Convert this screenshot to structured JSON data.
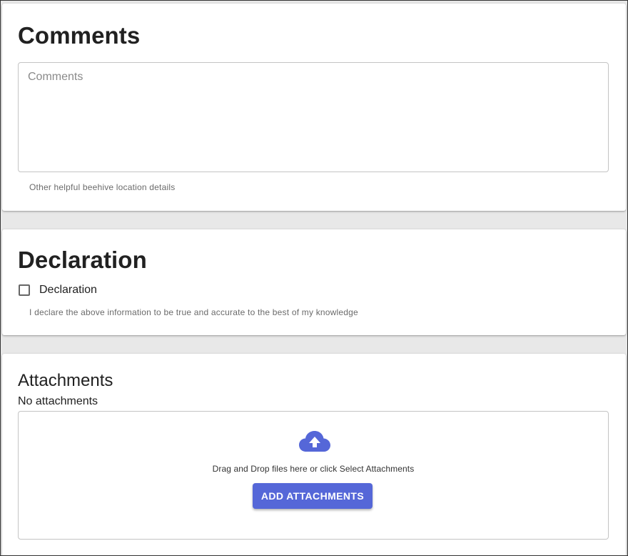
{
  "comments": {
    "title": "Comments",
    "field_placeholder": "Comments",
    "field_value": "",
    "helper": "Other helpful beehive location details"
  },
  "declaration": {
    "title": "Declaration",
    "checkbox_label": "Declaration",
    "checked": false,
    "helper": "I declare the above information to be true and accurate to the best of my knowledge"
  },
  "attachments": {
    "title": "Attachments",
    "empty_text": "No attachments",
    "drop_text": "Drag and Drop files here or click Select Attachments",
    "button_label": "ADD ATTACHMENTS",
    "icon": "cloud-upload-icon",
    "accent_color": "#5567d8"
  }
}
